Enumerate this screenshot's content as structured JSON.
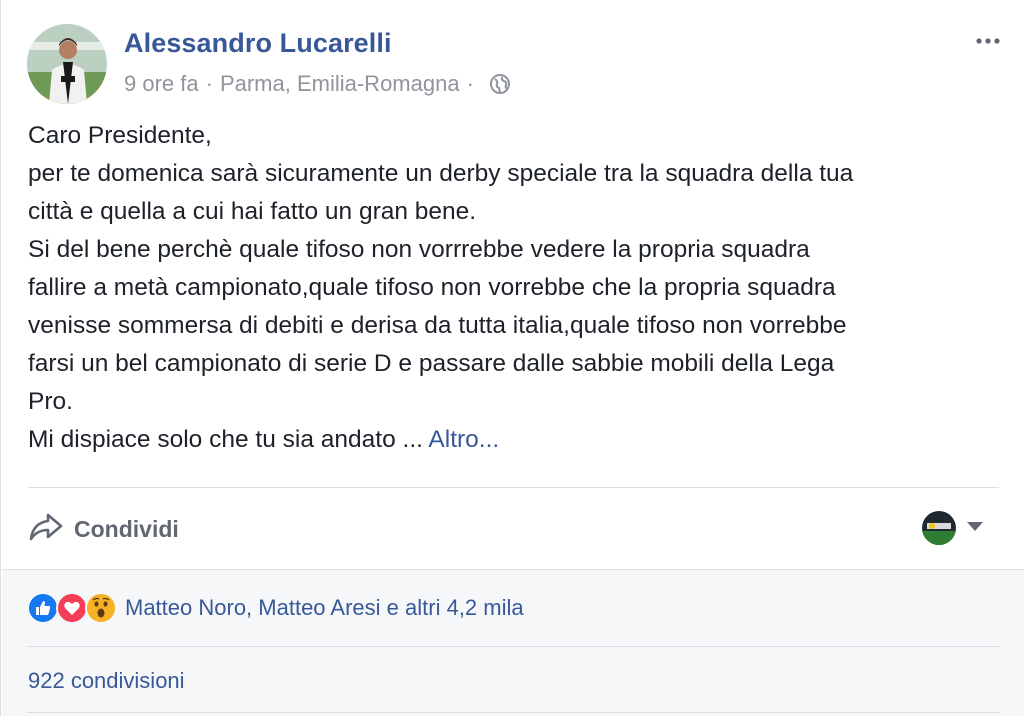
{
  "post": {
    "author": "Alessandro Lucarelli",
    "time": "9 ore fa",
    "location": "Parma, Emilia-Romagna",
    "separator": "·",
    "text_lines": [
      "Caro Presidente,",
      "per te domenica sarà sicuramente un derby speciale tra la squadra della tua",
      "città e quella a cui hai fatto un gran bene.",
      "Si del bene perchè quale tifoso non vorrrebbe vedere la propria squadra",
      "fallire a metà campionato,quale tifoso non vorrebbe che la propria squadra",
      "venisse sommersa di debiti e derisa da tutta italia,quale tifoso non vorrebbe",
      "farsi un bel campionato di serie D e passare dalle sabbie mobili della Lega",
      "Pro."
    ],
    "last_line": "Mi dispiace solo che tu sia andato ...",
    "see_more": "Altro..."
  },
  "actions": {
    "share_label": "Condividi"
  },
  "footer": {
    "reactors": "Matteo Noro, Matteo Aresi e altri 4,2 mila",
    "shares": "922 condivisioni"
  },
  "icons": {
    "privacy": "globe-icon",
    "menu": "more-options-icon",
    "share": "share-arrow-icon",
    "reactions": [
      "like-icon",
      "love-icon",
      "wow-icon"
    ]
  },
  "colors": {
    "link": "#385898",
    "meta": "#90949c",
    "like": "#1877f2",
    "love": "#f33e58",
    "wow": "#f7b125"
  }
}
